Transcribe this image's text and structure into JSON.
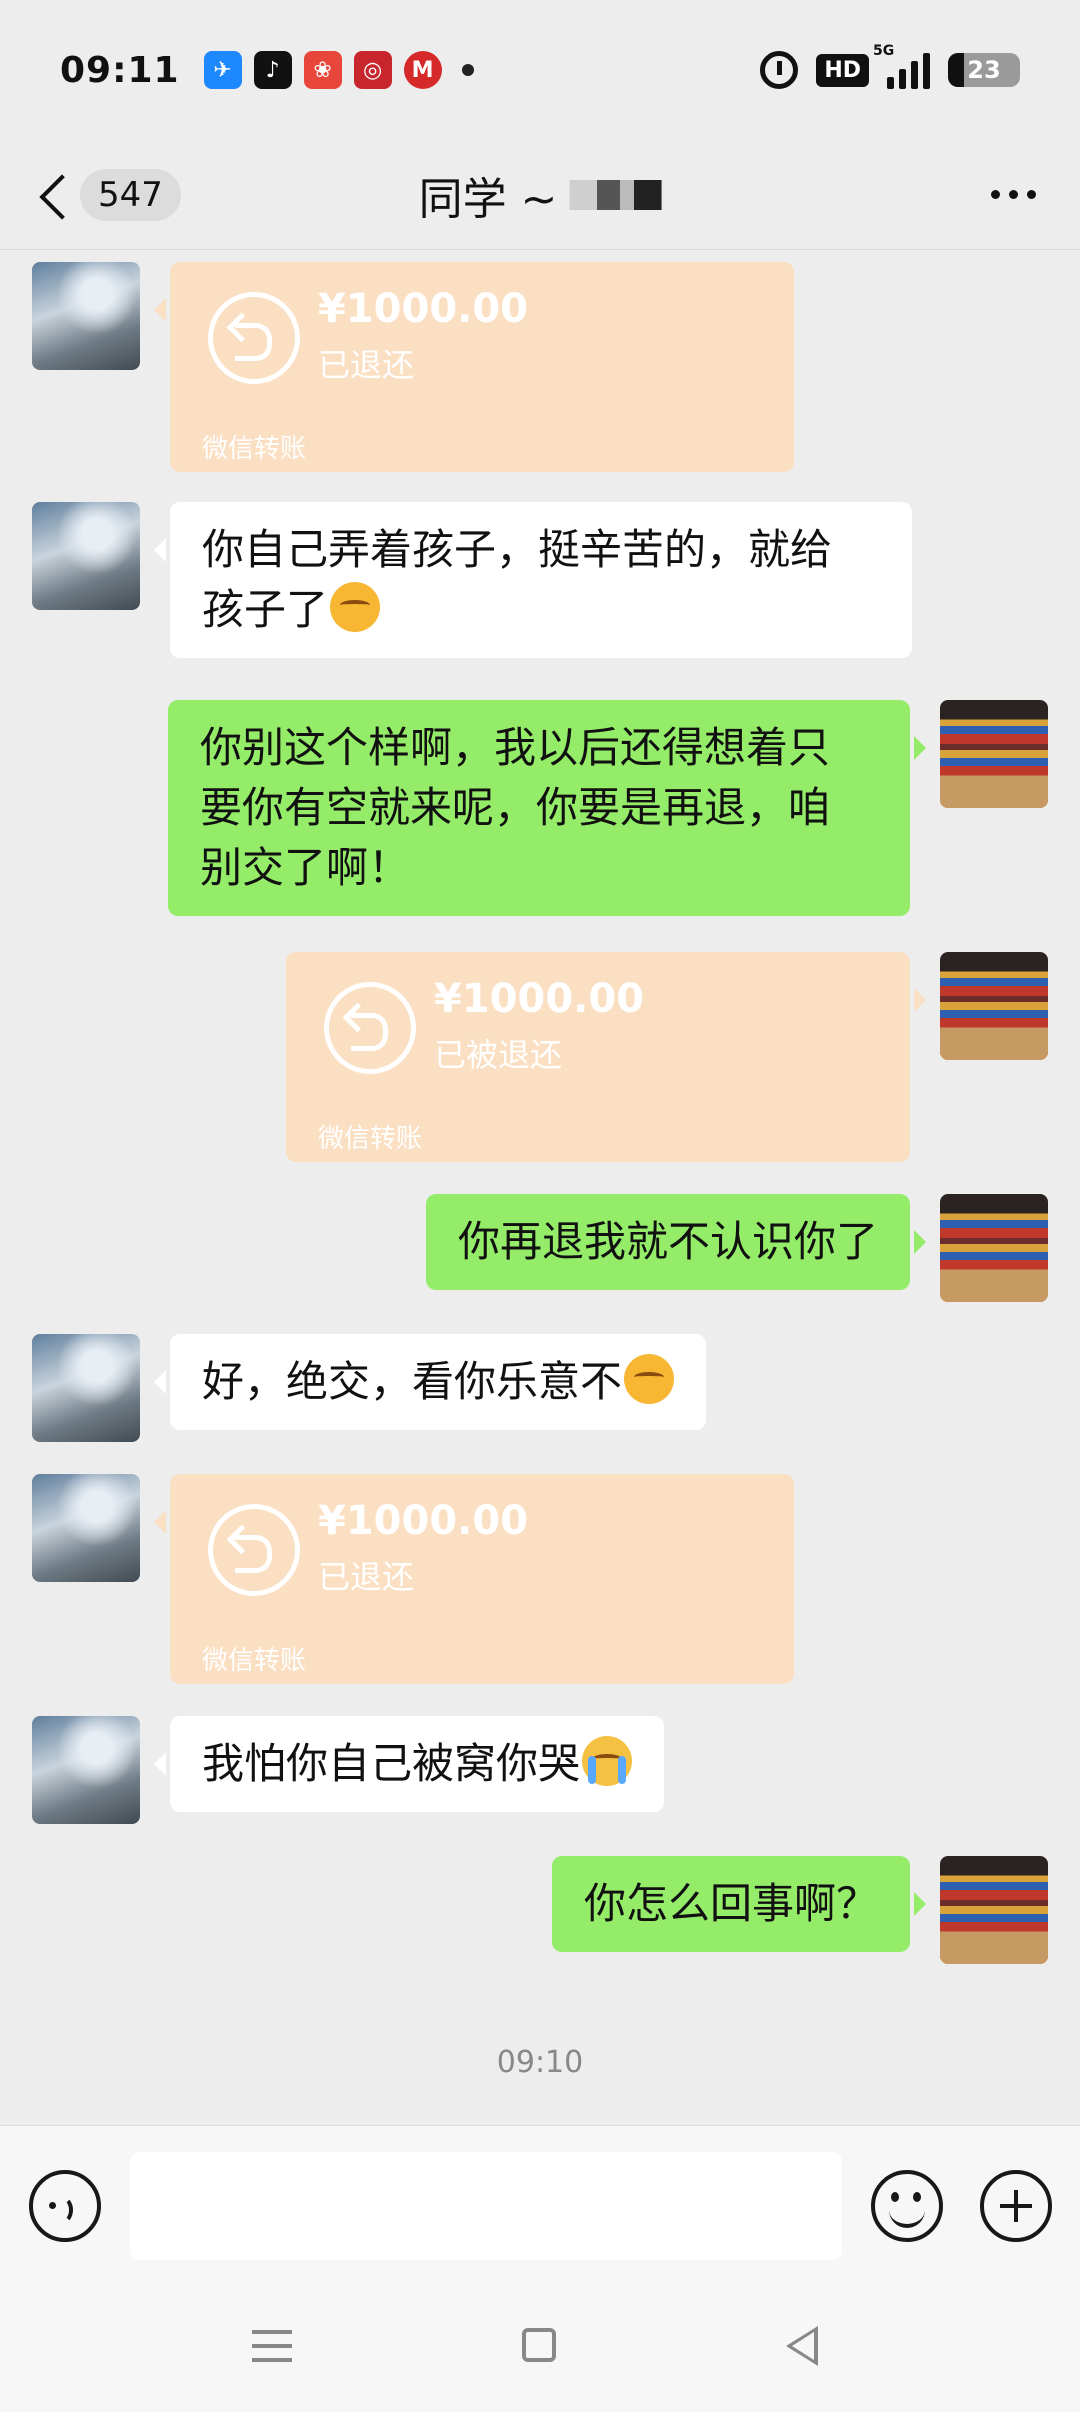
{
  "status_bar": {
    "time": "09:11",
    "notifications": [
      "feishu-icon",
      "tiktok-icon",
      "red-app-icon",
      "bank-icon",
      "merchants-bank-icon"
    ],
    "hd_label": "HD",
    "network_label": "5G",
    "battery_level": "23"
  },
  "header": {
    "unread_count": "547",
    "title": "同学 ~"
  },
  "messages": [
    {
      "side": "left",
      "type": "transfer",
      "amount": "¥1000.00",
      "status": "已退还",
      "label": "微信转账"
    },
    {
      "side": "left",
      "type": "text",
      "lines": [
        "你自己弄着孩子，挺辛苦的，就给",
        "孩子了"
      ],
      "emoji": "blush-emoji"
    },
    {
      "side": "right",
      "type": "text",
      "lines": [
        "你别这个样啊，我以后还得想着只",
        "要你有空就来呢，你要是再退，咱",
        "别交了啊！"
      ]
    },
    {
      "side": "right",
      "type": "transfer",
      "amount": "¥1000.00",
      "status": "已被退还",
      "label": "微信转账"
    },
    {
      "side": "right",
      "type": "text",
      "lines": [
        "你再退我就不认识你了"
      ]
    },
    {
      "side": "left",
      "type": "text",
      "lines": [
        "好，绝交，看你乐意不"
      ],
      "emoji": "blush-emoji"
    },
    {
      "side": "left",
      "type": "transfer",
      "amount": "¥1000.00",
      "status": "已退还",
      "label": "微信转账"
    },
    {
      "side": "left",
      "type": "text",
      "lines": [
        "我怕你自己被窝你哭"
      ],
      "emoji": "crying-emoji"
    },
    {
      "side": "right",
      "type": "text",
      "lines": [
        "你怎么回事啊？"
      ]
    }
  ],
  "timestamp": "09:10",
  "input_bar": {
    "value": "",
    "placeholder": ""
  },
  "colors": {
    "background": "#ededed",
    "self_bubble": "#95ec69",
    "other_bubble": "#ffffff",
    "transfer_card": "#fbdfc2"
  }
}
